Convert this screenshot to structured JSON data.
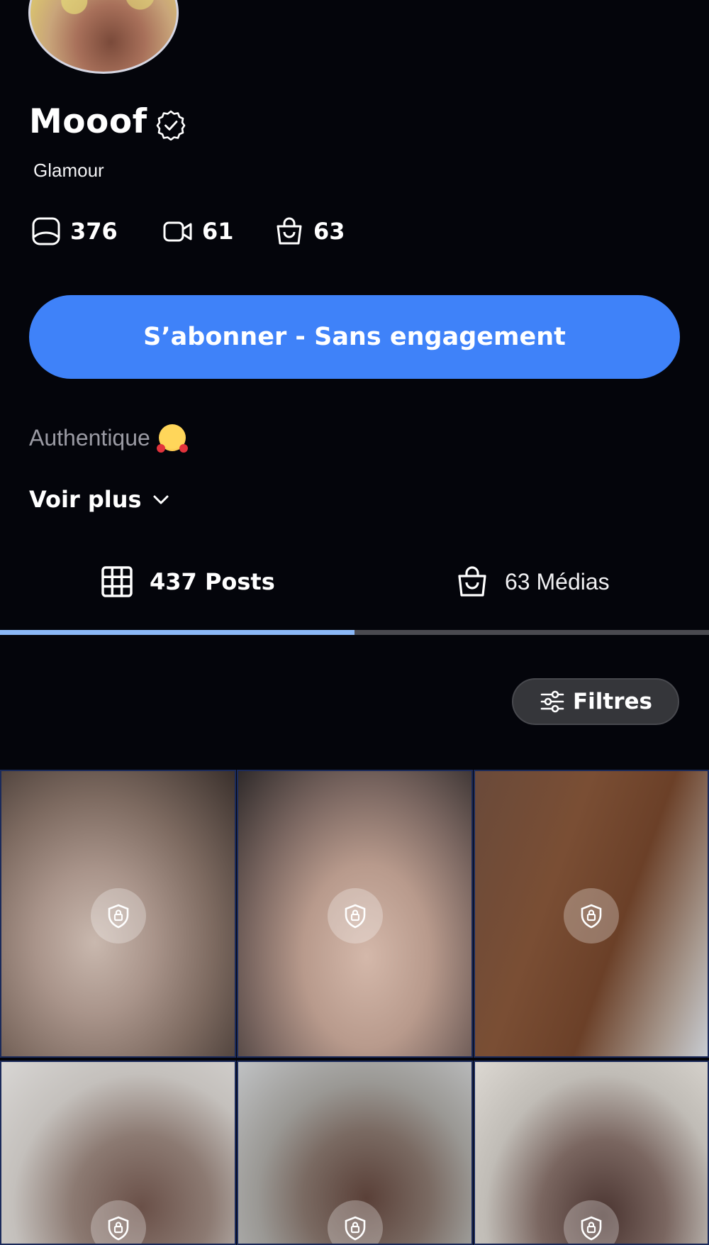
{
  "profile": {
    "name": "Mooof",
    "category": "Glamour",
    "stats": [
      {
        "icon": "photo-icon",
        "value": "376"
      },
      {
        "icon": "video-icon",
        "value": "61"
      },
      {
        "icon": "shopping-bag-icon",
        "value": "63"
      }
    ],
    "subscribe_label": "S’abonner - Sans engagement",
    "bio": "Authentique",
    "bio_emoji": "smiling-face-with-hearts-emoji",
    "see_more_label": "Voir plus"
  },
  "tabs": [
    {
      "icon": "grid-icon",
      "label": "437 Posts",
      "active": true
    },
    {
      "icon": "shopping-bag-icon",
      "label": "63 Médias",
      "active": false
    }
  ],
  "filters_label": "Filtres",
  "grid": {
    "tiles": [
      {
        "locked": true,
        "icon": "lock-shield-icon"
      },
      {
        "locked": true,
        "icon": "lock-shield-icon"
      },
      {
        "locked": true,
        "icon": "lock-shield-icon"
      },
      {
        "locked": true,
        "icon": "lock-shield-icon"
      },
      {
        "locked": true,
        "icon": "lock-shield-icon"
      },
      {
        "locked": true,
        "icon": "lock-shield-icon"
      }
    ]
  },
  "colors": {
    "background": "#04050b",
    "accent": "#3f82f9",
    "tab_indicator": "#8bb8f7",
    "muted_text": "#9a9aa3"
  }
}
